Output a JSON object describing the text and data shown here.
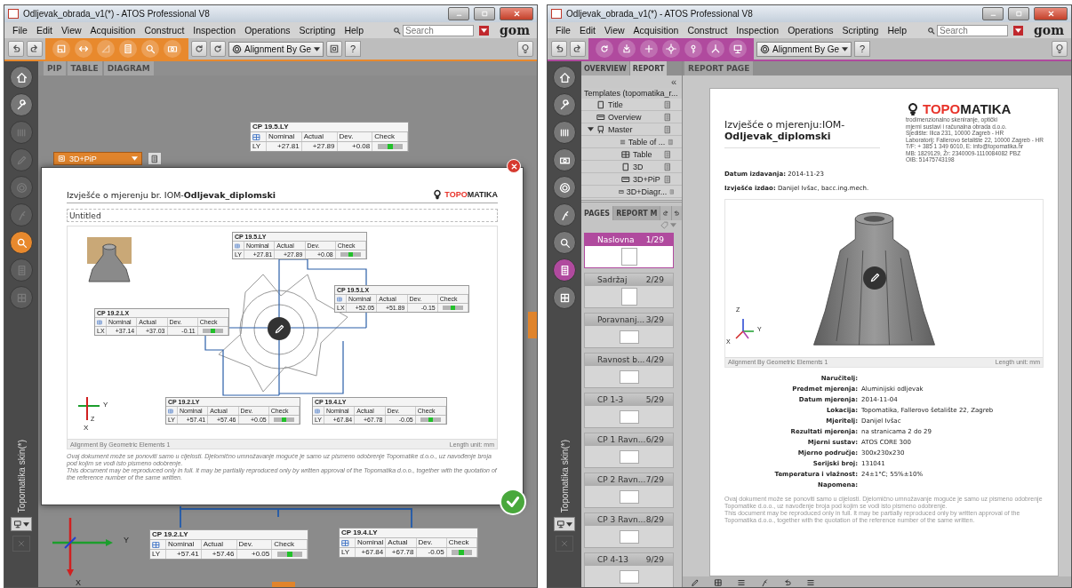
{
  "left_window": {
    "kind": "inspection",
    "title": "Odljevak_obrada_v1(*) - ATOS Professional V8",
    "menu": [
      "File",
      "Edit",
      "View",
      "Acquisition",
      "Construct",
      "Inspection",
      "Operations",
      "Scripting",
      "Help"
    ],
    "search": {
      "placeholder": "Search"
    },
    "logo": "gom",
    "alignment": "Alignment By Ge",
    "help": "?",
    "sidebar": {
      "items": [
        {
          "kind": "home",
          "selected": false,
          "disabled": false
        },
        {
          "kind": "wrench",
          "selected": false,
          "disabled": false
        },
        {
          "kind": "bars",
          "selected": false,
          "disabled": true
        },
        {
          "kind": "pen",
          "selected": false,
          "disabled": true
        },
        {
          "kind": "target",
          "selected": false,
          "disabled": true
        },
        {
          "kind": "probe",
          "selected": false,
          "disabled": true
        },
        {
          "kind": "search",
          "selected": true,
          "disabled": false
        },
        {
          "kind": "report",
          "selected": false,
          "disabled": true
        },
        {
          "kind": "grid",
          "selected": false,
          "disabled": true
        }
      ],
      "skin_label": "Topomatika skin(*)"
    },
    "view_tabs": [
      "PIP",
      "TABLE",
      "DIAGRAM"
    ],
    "dropdown": "3D+PiP",
    "background_tables": [
      {
        "title": "CP 19.5.LY",
        "columns": [
          "Nominal",
          "Actual",
          "Dev.",
          "Check"
        ],
        "axis": "LY",
        "nominal": "+27.81",
        "actual": "+27.89",
        "dev": "+0.08"
      },
      {
        "title": "CP 19.2.LY",
        "columns": [
          "Nominal",
          "Actual",
          "Dev.",
          "Check"
        ],
        "axis": "LY",
        "nominal": "+57.41",
        "actual": "+57.46",
        "dev": "+0.05"
      },
      {
        "title": "CP 19.4.LY",
        "columns": [
          "Nominal",
          "Actual",
          "Dev.",
          "Check"
        ],
        "axis": "LY",
        "nominal": "+67.84",
        "actual": "+67.78",
        "dev": "-0.05"
      }
    ],
    "axis": {
      "y": "Y",
      "x": "X"
    },
    "dialog": {
      "heading": "Izvješće o mjerenju br. IOM-**Odljevak_diplomski**",
      "logo_accent": "TOPO",
      "logo_rest": "MATIKA",
      "title_field": "Untitled",
      "tables": [
        {
          "title": "CP 19.5.LY",
          "columns": [
            "Nominal",
            "Actual",
            "Dev.",
            "Check"
          ],
          "axis": "LY",
          "nominal": "+27.81",
          "actual": "+27.89",
          "dev": "+0.08"
        },
        {
          "title": "CP 19.5.LX",
          "columns": [
            "Nominal",
            "Actual",
            "Dev.",
            "Check"
          ],
          "axis": "LX",
          "nominal": "+52.05",
          "actual": "+51.89",
          "dev": "-0.15"
        },
        {
          "title": "CP 19.2.LX",
          "columns": [
            "Nominal",
            "Actual",
            "Dev.",
            "Check"
          ],
          "axis": "LX",
          "nominal": "+37.14",
          "actual": "+37.03",
          "dev": "-0.11"
        },
        {
          "title": "CP 19.2.LY",
          "columns": [
            "Nominal",
            "Actual",
            "Dev.",
            "Check"
          ],
          "axis": "LY",
          "nominal": "+57.41",
          "actual": "+57.46",
          "dev": "+0.05"
        },
        {
          "title": "CP 19.4.LY",
          "columns": [
            "Nominal",
            "Actual",
            "Dev.",
            "Check"
          ],
          "axis": "LY",
          "nominal": "+67.84",
          "actual": "+67.78",
          "dev": "-0.05"
        }
      ],
      "axis": {
        "y": "Y",
        "z": "Z",
        "x": "X"
      },
      "footer_left": "Alignment By Geometric Elements 1",
      "footer_right": "Length unit: mm",
      "disclaimer": [
        "Ovaj dokument može se ponoviti samo u cijelosti. Djelomično umnožavanje moguće je samo uz pismeno odobrenje Topomatike d.o.o., uz navođenje broja pod kojim se vodi isto pismeno odobrenje.",
        "This document may be reproduced only in full. It may be partially reproduced only by written approval of the Topomatika d.o.o., together with the quotation of the reference number of the same written."
      ]
    }
  },
  "right_window": {
    "kind": "report",
    "title": "Odljevak_obrada_v1(*) - ATOS Professional V8",
    "menu": [
      "File",
      "Edit",
      "View",
      "Acquisition",
      "Construct",
      "Inspection",
      "Operations",
      "Scripting",
      "Help"
    ],
    "search": {
      "placeholder": "Search"
    },
    "logo": "gom",
    "alignment": "Alignment By Ge",
    "help": "?",
    "sidebar": {
      "items": [
        {
          "kind": "home",
          "selected": false,
          "disabled": false
        },
        {
          "kind": "wrench",
          "selected": false,
          "disabled": false
        },
        {
          "kind": "bars",
          "selected": false,
          "disabled": false
        },
        {
          "kind": "camera",
          "selected": false,
          "disabled": false
        },
        {
          "kind": "target",
          "selected": false,
          "disabled": false
        },
        {
          "kind": "probe",
          "selected": false,
          "disabled": false
        },
        {
          "kind": "search",
          "selected": false,
          "disabled": false
        },
        {
          "kind": "report",
          "selected": true,
          "disabled": false
        },
        {
          "kind": "grid",
          "selected": false,
          "disabled": false
        }
      ],
      "skin_label": "Topomatika skin(*)"
    },
    "panel_tabs": [
      {
        "label": "OVERVIEW",
        "selected": false
      },
      {
        "label": "REPORT",
        "selected": true
      }
    ],
    "collapse": "«",
    "templates": {
      "heading": "Templates (topomatika_r...",
      "items": [
        {
          "label": "Title"
        },
        {
          "label": "Overview"
        },
        {
          "label": "Master",
          "expanded": true,
          "children": [
            {
              "label": "Table of ..."
            },
            {
              "label": "Table"
            },
            {
              "label": "3D"
            },
            {
              "label": "3D+PiP"
            },
            {
              "label": "3D+Diagr..."
            }
          ]
        }
      ]
    },
    "page_tabs": [
      {
        "label": "PAGES",
        "selected": true
      },
      {
        "label": "REPORT M",
        "selected": false
      }
    ],
    "pages": [
      {
        "name": "Naslovna",
        "number": "1/29",
        "selected": true
      },
      {
        "name": "Sadržaj",
        "number": "2/29",
        "selected": false
      },
      {
        "name": "Poravnanj...",
        "number": "3/29",
        "selected": false
      },
      {
        "name": "Ravnost b...",
        "number": "4/29",
        "selected": false
      },
      {
        "name": "CP 1-3",
        "number": "5/29",
        "selected": false
      },
      {
        "name": "CP 1 Ravn...",
        "number": "6/29",
        "selected": false
      },
      {
        "name": "CP 2 Ravn...",
        "number": "7/29",
        "selected": false
      },
      {
        "name": "CP 3 Ravn...",
        "number": "8/29",
        "selected": false
      },
      {
        "name": "CP 4-13",
        "number": "9/29",
        "selected": false
      }
    ],
    "report_tab": "REPORT PAGE",
    "page": {
      "logo_accent": "TOPO",
      "logo_rest": "MATIKA",
      "heading": "Izvješće o mjerenju:IOM-**Odljevak_diplomski**",
      "company_lines": [
        "trodimenzionalno skeniranje, optički",
        "mjerni sustavi i računalna obrada d.o.o.",
        "Sjedište: Ilica 231, 10000 Zagreb - HR",
        "Laboratorij: Fallerovo šetalište 22, 10000 Zagreb - HR",
        "T/F: + 385 1 349 6010, E: info@topomatika.hr",
        "MB: 1829129, Žr: 2340009-1110084082 PBZ",
        "OIB: 51475743198"
      ],
      "issue_fields": [
        {
          "label": "Datum izdavanja:",
          "value": "2014-11-23"
        },
        {
          "label": "Izvješće izdao:",
          "value": "Danijel Ivšac, bacc.ing.mech."
        }
      ],
      "axis": {
        "z": "Z",
        "y": "Y",
        "x": "X"
      },
      "footer_left": "Alignment By Geometric Elements 1",
      "footer_right": "Length unit: mm",
      "details": [
        {
          "label": "Naručitelj:"
        },
        {
          "label": "Predmet mjerenja:",
          "value": "Aluminijski odljevak"
        },
        {
          "label": "Datum mjerenja:",
          "value": "2014-11-04"
        },
        {
          "label": "Lokacija:",
          "value": "Topomatika, Fallerovo šetalište 22, Zagreb"
        },
        {
          "label": "Mjeritelj:",
          "value": "Danijel Ivšac"
        },
        {
          "label": "Rezultati mjerenja:",
          "value": "na stranicama 2 do 29"
        },
        {
          "label": "Mjerni sustav:",
          "value": "ATOS CORE 300"
        },
        {
          "label": "Mjerno područje:",
          "value": "300x230x230"
        },
        {
          "label": "Serijski broj:",
          "value": "131041"
        },
        {
          "label": "Temperatura i vlažnost:",
          "value": "24±1°C; 55%±10%"
        },
        {
          "label": "Napomena:"
        }
      ],
      "disclaimer": [
        "Ovaj dokument može se ponoviti samo u cijelosti. Djelomično umnožavanje moguće je samo uz pismeno odobrenje Topomatike d.o.o., uz navođenje broja pod kojim se vodi isto pismeno odobrenje.",
        "This document may be reproduced only in full. It may be partially reproduced only by written approval of the Topomatika d.o.o., together with the quotation of the reference number of the same written."
      ]
    }
  }
}
